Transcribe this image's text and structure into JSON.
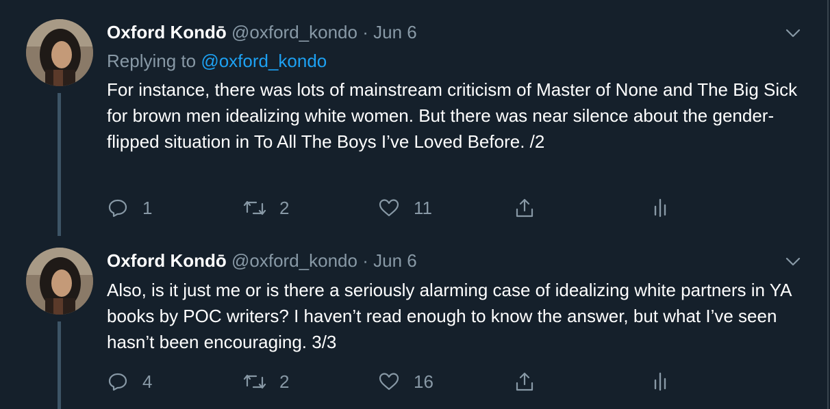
{
  "tweets": [
    {
      "name": "Oxford Kondō",
      "handle": "@oxford_kondo",
      "separator": "·",
      "date": "Jun 6",
      "replying_prefix": "Replying to",
      "replying_to": "@oxford_kondo",
      "text": "For instance, there was lots of mainstream criticism of Master of None and The Big Sick for brown men idealizing white women. But there was near silence about the gender-flipped situation in To All The Boys I’ve Loved Before. /2",
      "replies": "1",
      "retweets": "2",
      "likes": "11"
    },
    {
      "name": "Oxford Kondō",
      "handle": "@oxford_kondo",
      "separator": "·",
      "date": "Jun 6",
      "text": "Also, is it just me or is there a seriously alarming case of idealizing white partners in YA books by POC writers? I haven’t read enough to know the answer, but what I’ve seen hasn’t been encouraging. 3/3",
      "replies": "4",
      "retweets": "2",
      "likes": "16"
    }
  ],
  "icons": {
    "reply": "reply-icon",
    "retweet": "retweet-icon",
    "like": "heart-icon",
    "share": "share-icon",
    "analytics": "analytics-icon",
    "menu": "chevron-down-icon"
  },
  "colors": {
    "background": "#15202b",
    "text": "#ffffff",
    "secondary": "#8899a6",
    "link": "#1da1f2",
    "thread_line": "#3d5466"
  }
}
